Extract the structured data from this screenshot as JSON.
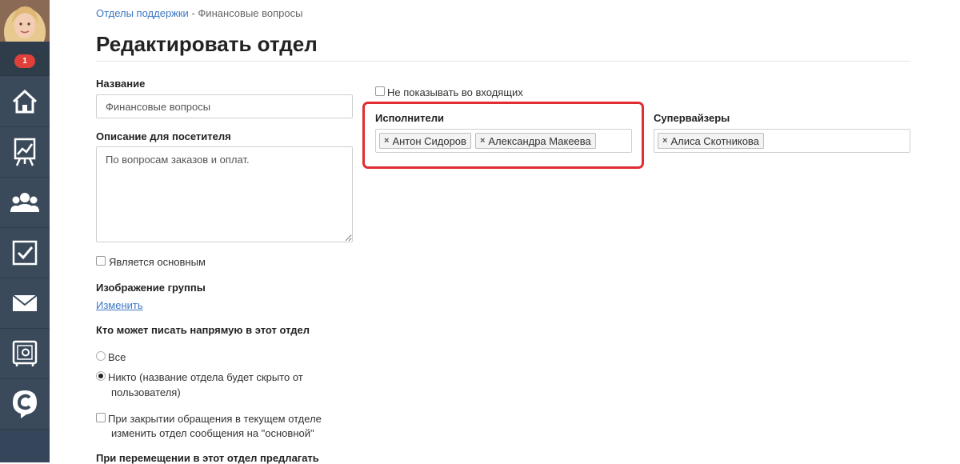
{
  "sidebar": {
    "badge_count": "1",
    "items": [
      {
        "name": "home",
        "icon": "home-icon"
      },
      {
        "name": "reports",
        "icon": "chart-easel-icon"
      },
      {
        "name": "users",
        "icon": "users-group-icon"
      },
      {
        "name": "tasks",
        "icon": "checkbox-icon"
      },
      {
        "name": "mail",
        "icon": "envelope-icon"
      },
      {
        "name": "settings",
        "icon": "safe-icon"
      },
      {
        "name": "brand",
        "icon": "chat-c-icon"
      }
    ]
  },
  "breadcrumb": {
    "parent": "Отделы поддержки",
    "separator": "-",
    "current": "Финансовые вопросы"
  },
  "page": {
    "title": "Редактировать отдел"
  },
  "form": {
    "name_label": "Название",
    "name_value": "Финансовые вопросы",
    "desc_label": "Описание для посетителя",
    "desc_value": "По вопросам заказов и оплат.",
    "is_main_label": "Является основным",
    "image_label": "Изображение группы",
    "image_change": "Изменить",
    "who_can_write_label": "Кто может писать напрямую в этот отдел",
    "radio_all": "Все",
    "radio_nobody_line1": "Никто (название отдела будет скрыто от",
    "radio_nobody_line2": "пользователя)",
    "on_close_line1": "При закрытии обращения в текущем отделе",
    "on_close_line2": "изменить отдел сообщения на \"основной\"",
    "move_suggest_label": "При перемещении в этот отдел предлагать",
    "hide_inbox_label": "Не показывать во входящих",
    "executors_label": "Исполнители",
    "executors": [
      "Антон Сидоров",
      "Александра Макеева"
    ],
    "supervisors_label": "Супервайзеры",
    "supervisors": [
      "Алиса Скотникова"
    ],
    "tag_remove_glyph": "×"
  },
  "colors": {
    "sidebar": "#3a4a5b",
    "link": "#3d78c4",
    "highlight": "#e02c32",
    "badge": "#e0403a"
  }
}
